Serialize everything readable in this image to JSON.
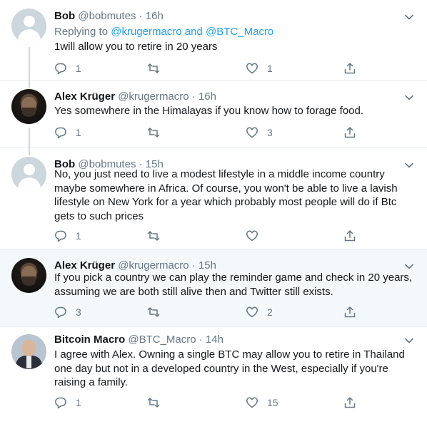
{
  "tweets": [
    {
      "name": "Bob",
      "handle": "@bobmutes",
      "time": "16h",
      "avatar": "default-avatar",
      "replying_prefix": "Replying to ",
      "replying_to": "@krugermacro and @BTC_Macro",
      "text": "1will allow you to retire in 20 years",
      "replies": "1",
      "retweets": "",
      "likes": "1"
    },
    {
      "name": "Alex Krüger",
      "handle": "@krugermacro",
      "time": "16h",
      "avatar": "alex-kruger-photo",
      "text": "Yes somewhere in the Himalayas if you know how to forage food.",
      "replies": "1",
      "retweets": "",
      "likes": "3"
    },
    {
      "name": "Bob",
      "handle": "@bobmutes",
      "time": "15h",
      "avatar": "default-avatar",
      "text": "No, you just need to live a modest lifestyle in a middle income country maybe somewhere in Africa. Of course, you won't be able to live a lavish lifestyle on New York for a year which probably most people will do if Btc gets to such prices",
      "replies": "1",
      "retweets": "",
      "likes": ""
    },
    {
      "name": "Alex Krüger",
      "handle": "@krugermacro",
      "time": "15h",
      "avatar": "alex-kruger-photo",
      "text": "If you pick a country we can play the reminder game and check in 20 years, assuming we are both still alive then and Twitter still exists.",
      "replies": "3",
      "retweets": "",
      "likes": "2"
    },
    {
      "name": "Bitcoin Macro",
      "handle": "@BTC_Macro",
      "time": "14h",
      "avatar": "bitcoin-macro-photo",
      "text": "I agree with Alex. Owning a single BTC may allow you to retire in Thailand one day but not in a developed country in the West, especially if you're raising a family.",
      "replies": "1",
      "retweets": "",
      "likes": "15"
    }
  ],
  "separator": "·",
  "colors": {
    "link": "#1da1f2",
    "secondary_text": "#657786",
    "highlight_bg": "#f5f8fa",
    "border": "#e6ecf0"
  }
}
